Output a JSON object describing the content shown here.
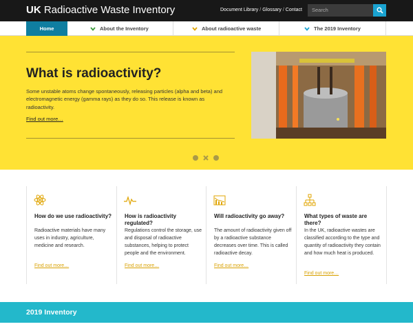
{
  "header": {
    "logo_bold": "UK",
    "logo_rest": " Radioactive Waste Inventory",
    "links": [
      "Document Library",
      "Glossary",
      "Contact"
    ],
    "link_separator": "/",
    "search_placeholder": "Search",
    "search_button_icon": "search-icon"
  },
  "nav": {
    "items": [
      {
        "label": "Home",
        "active": true
      },
      {
        "label": "About the Inventory",
        "chevron_color": "#3a9a3a"
      },
      {
        "label": "About radioactive waste",
        "chevron_color": "#e0a400"
      },
      {
        "label": "The 2019 Inventory",
        "chevron_color": "#1aa3d1"
      }
    ]
  },
  "hero": {
    "title": "What is radioactivity?",
    "body": "Some unstable atoms change spontaneously, releasing particles (alpha and beta) and electromagnetic energy (gamma rays) as they do so. This release is known as radioactivity.",
    "link": "Find out more…",
    "background": "#ffe234",
    "carousel_dots": 3,
    "carousel_active": 2
  },
  "cards": [
    {
      "icon": "atom-icon",
      "title": "How do we use radioactivity?",
      "text": "Radioactive materials have many uses in industry, agriculture, medicine and research.",
      "link": "Find out more…"
    },
    {
      "icon": "pulse-icon",
      "title": "How is radioactivity regulated?",
      "text": "Regulations control the storage, use and disposal of radioactive substances, helping to protect people and the environment.",
      "link": "Find out more…"
    },
    {
      "icon": "decay-chart-icon",
      "title": "Will radioactivity go away?",
      "text": "The amount of radioactivity given off by a radioactive substance decreases over time. This is called radioactive decay.",
      "link": "Find out more…"
    },
    {
      "icon": "hierarchy-icon",
      "title": "What types of waste are there?",
      "text": "In the UK, radioactive wastes are classified according to the type and quantity of radioactivity they contain and how much heat is produced.",
      "link": "Find out more…"
    }
  ],
  "band": {
    "title": "2019 Inventory",
    "background": "#23b8cb"
  },
  "colors": {
    "accent_orange": "#e0a400",
    "home_tab": "#0f7ea0"
  }
}
